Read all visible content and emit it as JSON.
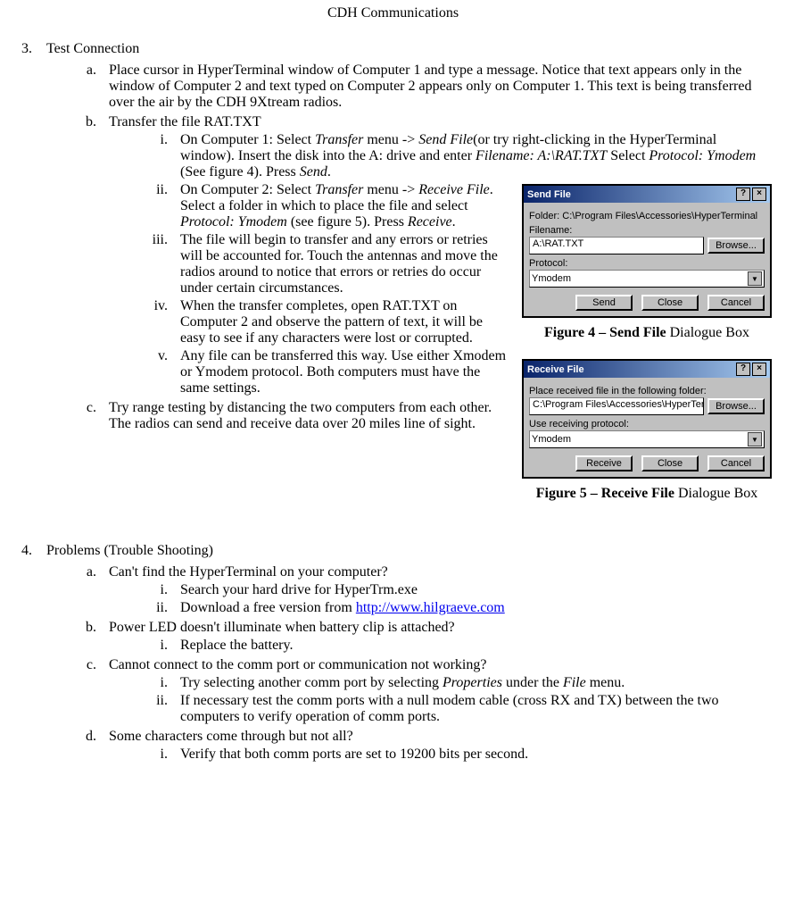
{
  "header": {
    "title": "CDH Communications"
  },
  "section3": {
    "marker": "3.",
    "title": "Test Connection",
    "a": "Place cursor in HyperTerminal window of Computer 1 and type a message. Notice that text appears only in the window of Computer 2 and text typed on Computer 2 appears only on Computer 1. This text is being transferred over the air by the CDH 9Xtream radios.",
    "b": "Transfer the file RAT.TXT",
    "b_i_pre": "On Computer 1: Select ",
    "b_i_it1": "Transfer",
    "b_i_mid1": " menu -> ",
    "b_i_it2": "Send File",
    "b_i_mid2": "(or try right-clicking in the HyperTerminal window). Insert the disk into the A: drive and enter ",
    "b_i_it3": "Filename: A:\\RAT.TXT",
    "b_i_mid3": "  Select ",
    "b_i_it4": "Protocol: Ymodem",
    "b_i_mid4": " (See figure 4). Press ",
    "b_i_it5": "Send",
    "b_i_end": ".",
    "b_ii_pre": "On Computer 2: Select ",
    "b_ii_it1": "Transfer",
    "b_ii_mid1": " menu -> ",
    "b_ii_it2": "Receive File",
    "b_ii_mid2": ". Select a folder in which to place the file and select ",
    "b_ii_it3": "Protocol: Ymodem",
    "b_ii_mid3": " (see figure 5). Press ",
    "b_ii_it4": "Receive",
    "b_ii_end": ".",
    "b_iii": "The file will begin to transfer and any errors or retries will be accounted for. Touch the antennas and move the radios around to notice that errors or retries do occur under certain circumstances.",
    "b_iv": "When the transfer completes, open RAT.TXT on Computer 2 and observe the pattern of text, it will be easy to see if any characters were lost or corrupted.",
    "b_v": "Any file can be transferred this way. Use either Xmodem or Ymodem protocol. Both computers must have the same settings.",
    "c": "Try range testing by distancing the two computers from each other. The radios can send and receive data over 20 miles line of sight."
  },
  "section4": {
    "marker": "4.",
    "title": "Problems (Trouble Shooting)",
    "a": "Can't find the HyperTerminal on your computer?",
    "a_i": "Search your hard drive for HyperTrm.exe",
    "a_ii_pre": "Download a free version from ",
    "a_ii_link": "http://www.hilgraeve.com",
    "b": "Power LED doesn't illuminate when battery clip is attached?",
    "b_i": "Replace the battery.",
    "c": "Cannot connect to the comm port or communication not working?",
    "c_i_pre": "Try selecting another comm port by selecting ",
    "c_i_it1": "Properties",
    "c_i_mid": " under the ",
    "c_i_it2": "File",
    "c_i_end": " menu.",
    "c_ii": "If necessary test the comm ports with a null modem cable (cross RX and TX) between the two computers to verify operation of comm ports.",
    "d": "Some characters come through but not all?",
    "d_i": "Verify that both comm ports are set to 19200 bits per second."
  },
  "fig4": {
    "title": "Send File",
    "folder_label": "Folder:  C:\\Program Files\\Accessories\\HyperTerminal",
    "filename_label": "Filename:",
    "filename_value": "A:\\RAT.TXT",
    "browse": "Browse...",
    "protocol_label": "Protocol:",
    "protocol_value": "Ymodem",
    "btn_send": "Send",
    "btn_close": "Close",
    "btn_cancel": "Cancel",
    "caption_bold": "Figure 4 – Send File",
    "caption_rest": " Dialogue Box"
  },
  "fig5": {
    "title": "Receive File",
    "folder_label": "Place received file in the following folder:",
    "folder_value": "C:\\Program Files\\Accessories\\HyperTerminal",
    "browse": "Browse...",
    "protocol_label": "Use receiving protocol:",
    "protocol_value": "Ymodem",
    "btn_receive": "Receive",
    "btn_close": "Close",
    "btn_cancel": "Cancel",
    "caption_bold": "Figure 5 – Receive File",
    "caption_rest": " Dialogue Box"
  }
}
